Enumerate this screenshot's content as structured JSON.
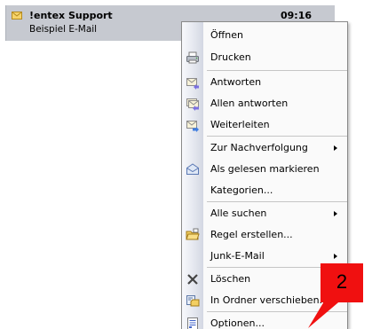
{
  "message": {
    "sender": "!entex Support",
    "subject": "Beispiel E-Mail",
    "time": "09:16"
  },
  "menu": {
    "items": [
      {
        "label": "Öffnen",
        "icon": ""
      },
      {
        "label": "Drucken",
        "icon": "printer-icon"
      },
      {
        "label": "Antworten",
        "icon": "reply-icon"
      },
      {
        "label": "Allen antworten",
        "icon": "reply-all-icon"
      },
      {
        "label": "Weiterleiten",
        "icon": "forward-icon"
      },
      {
        "label": "Zur Nachverfolgung",
        "icon": "",
        "submenu": true
      },
      {
        "label": "Als gelesen markieren",
        "icon": "mark-read-icon"
      },
      {
        "label": "Kategorien...",
        "icon": ""
      },
      {
        "label": "Alle suchen",
        "icon": "",
        "submenu": true
      },
      {
        "label": "Regel erstellen...",
        "icon": "rule-folder-icon"
      },
      {
        "label": "Junk-E-Mail",
        "icon": "",
        "submenu": true
      },
      {
        "label": "Löschen",
        "icon": "delete-icon"
      },
      {
        "label": "In Ordner verschieben...",
        "icon": "move-folder-icon"
      },
      {
        "label": "Optionen...",
        "icon": "options-icon"
      }
    ]
  },
  "callout": {
    "number": "2",
    "color": "#f01010"
  }
}
